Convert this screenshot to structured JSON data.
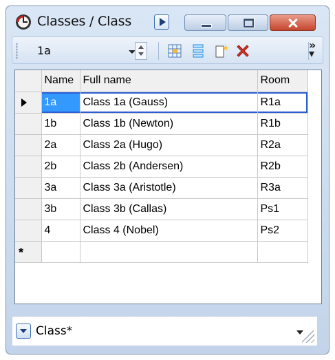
{
  "window": {
    "title": "Classes / Class"
  },
  "toolbar": {
    "selector_value": "1a",
    "icons": [
      "grid-icon",
      "form-icon",
      "new-record-icon",
      "delete-icon",
      "more-icon"
    ]
  },
  "grid": {
    "columns": [
      "Name",
      "Full name",
      "Room"
    ],
    "rows": [
      {
        "name": "1a",
        "full_name": "Class 1a (Gauss)",
        "room": "R1a"
      },
      {
        "name": "1b",
        "full_name": "Class 1b (Newton)",
        "room": "R1b"
      },
      {
        "name": "2a",
        "full_name": "Class 2a (Hugo)",
        "room": "R2a"
      },
      {
        "name": "2b",
        "full_name": "Class 2b (Andersen)",
        "room": "R2b"
      },
      {
        "name": "3a",
        "full_name": "Class 3a (Aristotle)",
        "room": "R3a"
      },
      {
        "name": "3b",
        "full_name": "Class 3b (Callas)",
        "room": "Ps1"
      },
      {
        "name": "4",
        "full_name": "Class 4 (Nobel)",
        "room": "Ps2"
      }
    ],
    "new_row_marker": "*"
  },
  "status": {
    "view_label": "Class*"
  },
  "colors": {
    "selection": "#3399ff",
    "focus_border": "#2a5fd4",
    "close_button": "#c4452e"
  }
}
